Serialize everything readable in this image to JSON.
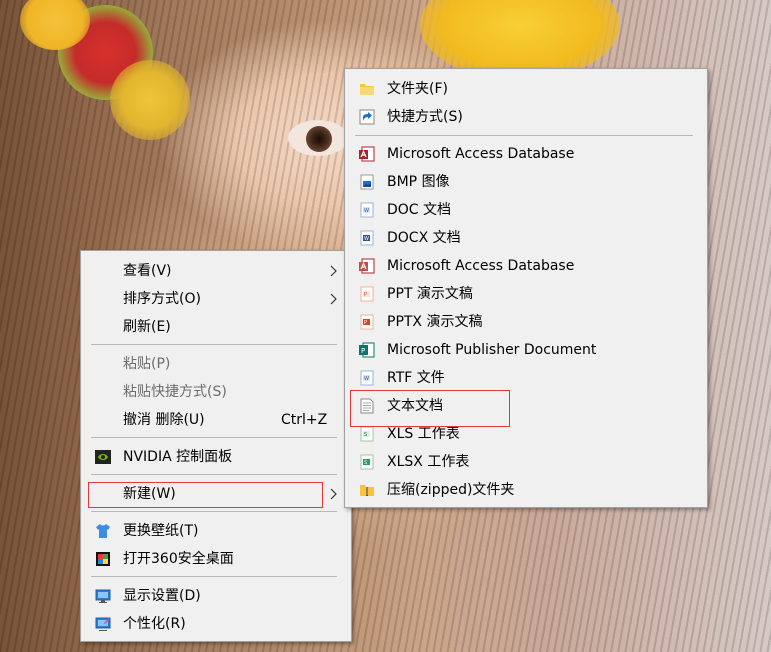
{
  "context_menu": {
    "items": [
      {
        "label": "查看(V)",
        "has_submenu": true
      },
      {
        "label": "排序方式(O)",
        "has_submenu": true
      },
      {
        "label": "刷新(E)"
      },
      {
        "label": "粘贴(P)",
        "disabled": true
      },
      {
        "label": "粘贴快捷方式(S)",
        "disabled": true
      },
      {
        "label": "撤消 删除(U)",
        "shortcut": "Ctrl+Z"
      },
      {
        "label": "NVIDIA 控制面板",
        "icon": "nvidia-icon"
      },
      {
        "label": "新建(W)",
        "has_submenu": true,
        "highlighted": true
      },
      {
        "label": "更换壁纸(T)",
        "icon": "tshirt-icon"
      },
      {
        "label": "打开360安全桌面",
        "icon": "360-desktop-icon"
      },
      {
        "label": "显示设置(D)",
        "icon": "display-icon"
      },
      {
        "label": "个性化(R)",
        "icon": "personalize-icon"
      }
    ]
  },
  "new_submenu": {
    "items": [
      {
        "label": "文件夹(F)",
        "icon": "folder-icon"
      },
      {
        "label": "快捷方式(S)",
        "icon": "shortcut-icon"
      },
      {
        "label": "Microsoft Access Database",
        "icon": "access-icon"
      },
      {
        "label": "BMP 图像",
        "icon": "bmp-icon"
      },
      {
        "label": "DOC 文档",
        "icon": "doc-icon"
      },
      {
        "label": "DOCX 文档",
        "icon": "docx-icon"
      },
      {
        "label": "Microsoft Access Database",
        "icon": "access-icon"
      },
      {
        "label": "PPT 演示文稿",
        "icon": "ppt-icon"
      },
      {
        "label": "PPTX 演示文稿",
        "icon": "pptx-icon"
      },
      {
        "label": "Microsoft Publisher Document",
        "icon": "publisher-icon"
      },
      {
        "label": "RTF 文件",
        "icon": "rtf-icon"
      },
      {
        "label": "文本文档",
        "icon": "text-document-icon",
        "highlighted": true
      },
      {
        "label": "XLS 工作表",
        "icon": "xls-icon"
      },
      {
        "label": "XLSX 工作表",
        "icon": "xlsx-icon"
      },
      {
        "label": "压缩(zipped)文件夹",
        "icon": "zip-folder-icon"
      }
    ]
  },
  "colors": {
    "menu_bg": "#f0f0f0",
    "menu_border": "#a0a0a0",
    "disabled_text": "#6d6d6d",
    "highlight_box": "#e53935"
  }
}
